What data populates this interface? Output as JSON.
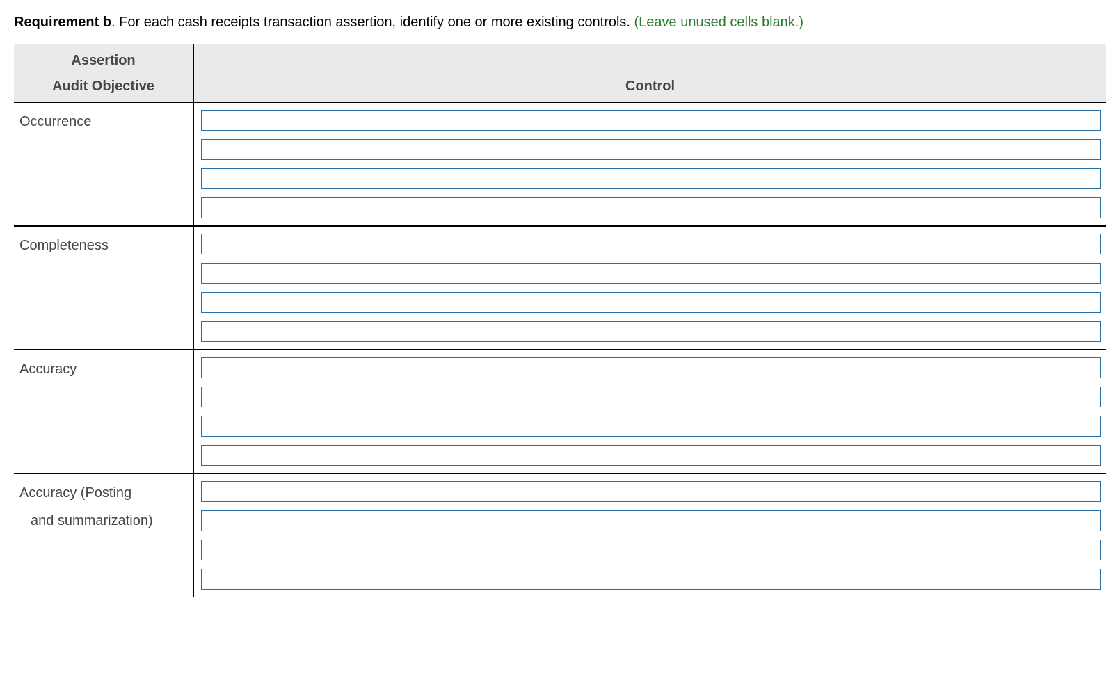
{
  "requirement": {
    "label": "Requirement b",
    "text": ". For each cash receipts transaction assertion, identify one or more existing controls. ",
    "note": "(Leave unused cells blank.)"
  },
  "headers": {
    "assertion_line1": "Assertion",
    "assertion_line2": "Audit Objective",
    "control": "Control"
  },
  "rows": [
    {
      "label": "Occurrence",
      "label_extra": null,
      "controls": [
        "",
        "",
        "",
        ""
      ]
    },
    {
      "label": "Completeness",
      "label_extra": null,
      "controls": [
        "",
        "",
        "",
        ""
      ]
    },
    {
      "label": "Accuracy",
      "label_extra": null,
      "controls": [
        "",
        "",
        "",
        ""
      ]
    },
    {
      "label": "Accuracy (Posting",
      "label_extra": "and summarization)",
      "controls": [
        "",
        "",
        "",
        ""
      ]
    }
  ]
}
